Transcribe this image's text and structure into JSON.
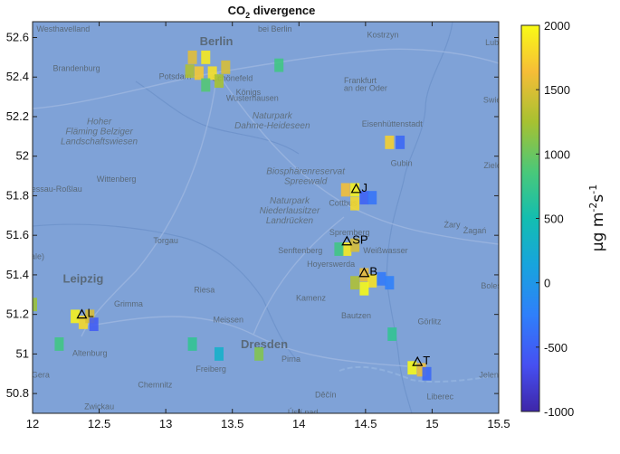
{
  "chart_data": {
    "type": "heatmap",
    "title_main": "CO",
    "title_sub": "2",
    "title_rest": " divergence",
    "xlim": [
      12,
      15.5
    ],
    "ylim": [
      50.7,
      52.68
    ],
    "x_ticks": [
      "12",
      "12.5",
      "13",
      "13.5",
      "14",
      "14.5",
      "15",
      "15.5"
    ],
    "y_ticks": [
      "50.8",
      "51",
      "51.2",
      "51.4",
      "51.6",
      "51.8",
      "52",
      "52.2",
      "52.4",
      "52.6"
    ],
    "colorbar": {
      "range": [
        -1000,
        2000
      ],
      "ticks": [
        "2000",
        "1500",
        "1000",
        "500",
        "0",
        "-500",
        "-1000"
      ],
      "label_mu": "μg m",
      "label_exp1": "-2",
      "label_s": "s",
      "label_exp2": "-1"
    },
    "background_value": 0,
    "cells": [
      {
        "lon": 13.2,
        "lat": 52.5,
        "value": 1550
      },
      {
        "lon": 13.3,
        "lat": 52.5,
        "value": 1900
      },
      {
        "lon": 13.25,
        "lat": 52.42,
        "value": 1700
      },
      {
        "lon": 13.35,
        "lat": 52.42,
        "value": 1850
      },
      {
        "lon": 13.45,
        "lat": 52.45,
        "value": 1500
      },
      {
        "lon": 13.4,
        "lat": 52.38,
        "value": 1250
      },
      {
        "lon": 13.18,
        "lat": 52.43,
        "value": 1300
      },
      {
        "lon": 13.3,
        "lat": 52.36,
        "value": 900
      },
      {
        "lon": 13.85,
        "lat": 52.46,
        "value": 800
      },
      {
        "lon": 14.68,
        "lat": 52.07,
        "value": 1750
      },
      {
        "lon": 14.76,
        "lat": 52.07,
        "value": -450
      },
      {
        "lon": 14.42,
        "lat": 51.83,
        "value": 1950
      },
      {
        "lon": 14.35,
        "lat": 51.83,
        "value": 1650
      },
      {
        "lon": 14.42,
        "lat": 51.76,
        "value": 1800
      },
      {
        "lon": 14.49,
        "lat": 51.79,
        "value": -500
      },
      {
        "lon": 14.55,
        "lat": 51.79,
        "value": -350
      },
      {
        "lon": 14.36,
        "lat": 51.53,
        "value": 1900
      },
      {
        "lon": 14.42,
        "lat": 51.55,
        "value": 1500
      },
      {
        "lon": 14.3,
        "lat": 51.53,
        "value": 800
      },
      {
        "lon": 14.49,
        "lat": 51.4,
        "value": 1600
      },
      {
        "lon": 14.55,
        "lat": 51.37,
        "value": 1850
      },
      {
        "lon": 14.49,
        "lat": 51.33,
        "value": 2000
      },
      {
        "lon": 14.42,
        "lat": 51.36,
        "value": 1300
      },
      {
        "lon": 14.62,
        "lat": 51.38,
        "value": -300
      },
      {
        "lon": 14.68,
        "lat": 51.36,
        "value": -250
      },
      {
        "lon": 12.32,
        "lat": 51.19,
        "value": 1950
      },
      {
        "lon": 12.38,
        "lat": 51.16,
        "value": 1800
      },
      {
        "lon": 12.43,
        "lat": 51.19,
        "value": 1500
      },
      {
        "lon": 12.46,
        "lat": 51.15,
        "value": -550
      },
      {
        "lon": 12.0,
        "lat": 51.25,
        "value": 1200
      },
      {
        "lon": 14.85,
        "lat": 50.93,
        "value": 2000
      },
      {
        "lon": 14.92,
        "lat": 50.92,
        "value": 1600
      },
      {
        "lon": 14.96,
        "lat": 50.9,
        "value": -450
      },
      {
        "lon": 13.7,
        "lat": 51.0,
        "value": 1100
      },
      {
        "lon": 13.2,
        "lat": 51.05,
        "value": 700
      },
      {
        "lon": 14.7,
        "lat": 51.1,
        "value": 700
      },
      {
        "lon": 13.4,
        "lat": 51.0,
        "value": 300
      },
      {
        "lon": 12.2,
        "lat": 51.05,
        "value": 800
      }
    ],
    "markers": [
      {
        "label": "J",
        "lon": 14.43,
        "lat": 51.835
      },
      {
        "label": "SP",
        "lon": 14.36,
        "lat": 51.57
      },
      {
        "label": "B",
        "lon": 14.49,
        "lat": 51.41
      },
      {
        "label": "L",
        "lon": 12.37,
        "lat": 51.2
      },
      {
        "label": "T",
        "lon": 14.89,
        "lat": 50.96
      }
    ]
  },
  "map_labels": {
    "large": [
      {
        "text": "Berlin",
        "lon": 13.38,
        "lat": 52.56
      },
      {
        "text": "Leipzig",
        "lon": 12.38,
        "lat": 51.36
      },
      {
        "text": "Dresden",
        "lon": 13.74,
        "lat": 51.03
      }
    ],
    "small": [
      {
        "text": "Westhavelland",
        "lon": 12.23,
        "lat": 52.63
      },
      {
        "text": "bei Berlin",
        "lon": 13.82,
        "lat": 52.63
      },
      {
        "text": "Kostrzyn",
        "lon": 14.63,
        "lat": 52.6
      },
      {
        "text": "Brandenburg",
        "lon": 12.33,
        "lat": 52.43
      },
      {
        "text": "Potsdam",
        "lon": 13.07,
        "lat": 52.39
      },
      {
        "text": "Schönefeld",
        "lon": 13.5,
        "lat": 52.38
      },
      {
        "text": "Frankfurt",
        "lon": 14.46,
        "lat": 52.37
      },
      {
        "text": "an der Oder",
        "lon": 14.5,
        "lat": 52.33
      },
      {
        "text": "Königs",
        "lon": 13.62,
        "lat": 52.31
      },
      {
        "text": "Wusterhausen",
        "lon": 13.65,
        "lat": 52.28
      },
      {
        "text": "Eisenhüttenstadt",
        "lon": 14.7,
        "lat": 52.15
      },
      {
        "text": "Wittenberg",
        "lon": 12.63,
        "lat": 51.87
      },
      {
        "text": "Cottbus",
        "lon": 14.33,
        "lat": 51.75
      },
      {
        "text": "Gubin",
        "lon": 14.77,
        "lat": 51.95
      },
      {
        "text": "Zielon",
        "lon": 15.47,
        "lat": 51.94
      },
      {
        "text": "Dessau-Roßlau",
        "lon": 12.16,
        "lat": 51.82
      },
      {
        "text": "Torgau",
        "lon": 13.0,
        "lat": 51.56
      },
      {
        "text": "Spremberg",
        "lon": 14.38,
        "lat": 51.6
      },
      {
        "text": "Senftenberg",
        "lon": 14.01,
        "lat": 51.51
      },
      {
        "text": "Weißwasser",
        "lon": 14.65,
        "lat": 51.51
      },
      {
        "text": "Hoyerswerda",
        "lon": 14.24,
        "lat": 51.44
      },
      {
        "text": "Żary",
        "lon": 15.15,
        "lat": 51.64
      },
      {
        "text": "Żagań",
        "lon": 15.32,
        "lat": 51.61
      },
      {
        "text": "Riesa",
        "lon": 13.29,
        "lat": 51.31
      },
      {
        "text": "Grimma",
        "lon": 12.72,
        "lat": 51.24
      },
      {
        "text": "Kamenz",
        "lon": 14.09,
        "lat": 51.27
      },
      {
        "text": "Bautzen",
        "lon": 14.43,
        "lat": 51.18
      },
      {
        "text": "Meissen",
        "lon": 13.47,
        "lat": 51.16
      },
      {
        "text": "Görlitz",
        "lon": 14.98,
        "lat": 51.15
      },
      {
        "text": "Altenburg",
        "lon": 12.43,
        "lat": 50.99
      },
      {
        "text": "Freiberg",
        "lon": 13.34,
        "lat": 50.91
      },
      {
        "text": "Pirna",
        "lon": 13.94,
        "lat": 50.96
      },
      {
        "text": "Chemnitz",
        "lon": 12.92,
        "lat": 50.83
      },
      {
        "text": "Zwickau",
        "lon": 12.5,
        "lat": 50.72
      },
      {
        "text": "Děčín",
        "lon": 14.2,
        "lat": 50.78
      },
      {
        "text": "Liberec",
        "lon": 15.06,
        "lat": 50.77
      },
      {
        "text": "Ústí nad",
        "lon": 14.03,
        "lat": 50.69
      },
      {
        "text": "Gera",
        "lon": 12.06,
        "lat": 50.88
      },
      {
        "text": "Saale)",
        "lon": 12.0,
        "lat": 51.48
      },
      {
        "text": "Lub",
        "lon": 15.45,
        "lat": 52.56
      },
      {
        "text": "Swie",
        "lon": 15.45,
        "lat": 52.27
      },
      {
        "text": "Jelenia",
        "lon": 15.45,
        "lat": 50.88
      },
      {
        "text": "Bolesł",
        "lon": 15.45,
        "lat": 51.33
      }
    ],
    "regions": [
      {
        "lines": [
          "Naturpark",
          "Dahme-Heideseen"
        ],
        "lon": 13.8,
        "lat": 52.19
      },
      {
        "lines": [
          "Hoher",
          "Fläming Belziger",
          "Landschaftswiesen"
        ],
        "lon": 12.5,
        "lat": 52.16
      },
      {
        "lines": [
          "Biosphärenreservat",
          "Spreewald"
        ],
        "lon": 14.05,
        "lat": 51.91
      },
      {
        "lines": [
          "Naturpark",
          "Niederlausitzer",
          "Landrücken"
        ],
        "lon": 13.93,
        "lat": 51.76
      }
    ]
  }
}
